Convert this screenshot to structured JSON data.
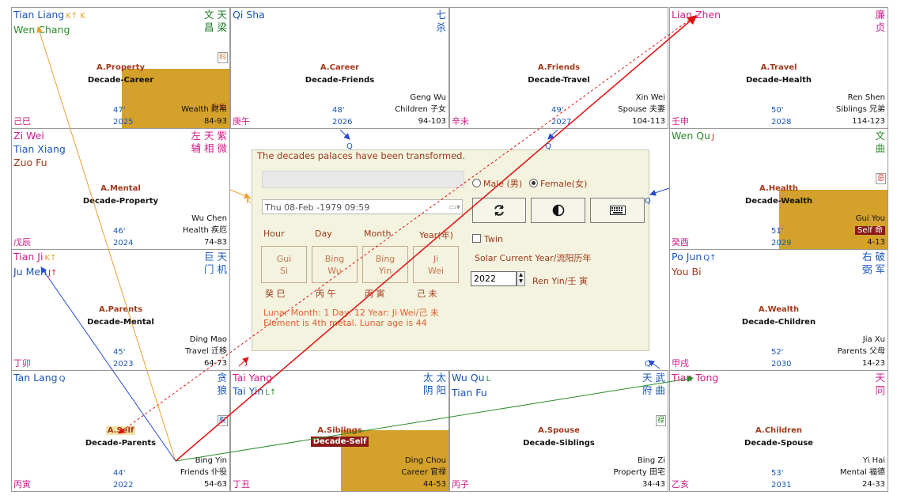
{
  "palaces": [
    {
      "id": "si",
      "stars_left": [
        {
          "text": "Tian Liang",
          "color": "#1a56b8",
          "mark": "K↑ K",
          "mark_color": "#e0a020"
        },
        {
          "text": "Wen Chang",
          "color": "#2a8a2a"
        }
      ],
      "stars_right": "文 天\n昌 梁",
      "stars_right_color": "#1a7a2a",
      "palace": "A.Property",
      "decade": "Decade-Career",
      "branch": "己巳",
      "age": "47'",
      "year": "2025",
      "palace_name": "Wealth 财帛",
      "range": "84-93",
      "major": "",
      "badge": "科",
      "badge_color": "#c87a3a",
      "gold": true,
      "kstr": "Ji Si"
    },
    {
      "id": "wu",
      "stars_left": [
        {
          "text": "Qi Sha",
          "color": "#1a56b8"
        }
      ],
      "stars_right": "七\n杀",
      "stars_right_color": "#1a56b8",
      "palace": "A.Career",
      "decade": "Decade-Friends",
      "branch": "庚午",
      "age": "48'",
      "year": "2026",
      "palace_name": "Children 子女",
      "range": "94-103",
      "major": "Geng Wu"
    },
    {
      "id": "wei",
      "stars_left": [],
      "stars_right": "",
      "palace": "A.Friends",
      "decade": "Decade-Travel",
      "branch": "辛未",
      "age": "49'",
      "year": "2027",
      "palace_name": "Spouse 夫妻",
      "range": "104-113",
      "major": "Xin Wei"
    },
    {
      "id": "shen",
      "stars_left": [
        {
          "text": "Lian Zhen",
          "color": "#cc1e8a"
        }
      ],
      "stars_right": "廉\n贞",
      "stars_right_color": "#cc1e8a",
      "palace": "A.Travel",
      "decade": "Decade-Health",
      "branch": "壬申",
      "age": "50'",
      "year": "2028",
      "palace_name": "Siblings 兄弟",
      "range": "114-123",
      "major": "Ren Shen"
    },
    {
      "id": "chen",
      "stars_left": [
        {
          "text": "Zi Wei",
          "color": "#cc1e8a"
        },
        {
          "text": "Tian Xiang",
          "color": "#1a56b8"
        },
        {
          "text": "Zuo Fu",
          "color": "#a03a1c"
        }
      ],
      "stars_right": "左 天 紫\n辅 相 微",
      "stars_right_color": "#cc1e8a",
      "palace": "A.Mental",
      "decade": "Decade-Property",
      "branch": "戊辰",
      "age": "46'",
      "year": "2024",
      "palace_name": "Health 疾厄",
      "range": "74-83",
      "major": "Wu Chen"
    },
    {
      "id": "you",
      "stars_left": [
        {
          "text": "Wen Qu",
          "color": "#2a8a2a",
          "mark": "J",
          "mark_color": "#c22"
        }
      ],
      "stars_right": "文\n曲",
      "stars_right_color": "#2a8a2a",
      "palace": "A.Health",
      "decade": "Decade-Wealth",
      "branch": "癸酉",
      "age": "51'",
      "year": "2029",
      "palace_name": "Self 命",
      "range": "4-13",
      "major": "Gui You",
      "badge": "忌",
      "badge_color": "#c22",
      "gold": true,
      "self_name": true
    },
    {
      "id": "mao",
      "stars_left": [
        {
          "text": "Tian Ji",
          "color": "#cc1e8a",
          "mark": "K↑",
          "mark_color": "#e0a020"
        },
        {
          "text": "Ju Men",
          "color": "#1a56b8",
          "mark": "J↑",
          "mark_color": "#c22"
        }
      ],
      "stars_right": "巨 天\n门 机",
      "stars_right_color": "#1a56b8",
      "palace": "A.Parents",
      "decade": "Decade-Mental",
      "branch": "丁卯",
      "age": "45'",
      "year": "2023",
      "palace_name": "Travel 迁移",
      "range": "64-73",
      "major": "Ding Mao"
    },
    {
      "id": "xu",
      "stars_left": [
        {
          "text": "Po Jun",
          "color": "#1a56b8",
          "mark": "Q↑",
          "mark_color": "#1a56b8"
        },
        {
          "text": "You Bi",
          "color": "#a03a1c"
        }
      ],
      "stars_right": "右 破\n弼 军",
      "stars_right_color": "#1a56b8",
      "palace": "A.Wealth",
      "decade": "Decade-Children",
      "branch": "甲戌",
      "age": "52'",
      "year": "2030",
      "palace_name": "Parents 父母",
      "range": "14-23",
      "major": "Jia Xu"
    },
    {
      "id": "yin",
      "stars_left": [
        {
          "text": "Tan Lang",
          "color": "#1a56b8",
          "mark": "Q",
          "mark_color": "#1a56b8"
        }
      ],
      "stars_right": "贪\n狼",
      "stars_right_color": "#1a56b8",
      "palace": "A.Self",
      "decade": "Decade-Parents",
      "branch": "丙寅",
      "age": "44'",
      "year": "2022",
      "palace_name": "Friends 仆役",
      "range": "54-63",
      "major": "Bing Yin",
      "badge": "权",
      "badge_color": "#1a56b8",
      "hl": true
    },
    {
      "id": "chou",
      "stars_left": [
        {
          "text": "Tai Yang",
          "color": "#cc1e8a"
        },
        {
          "text": "Tai Yin",
          "color": "#1a56b8",
          "mark": "L↑",
          "mark_color": "#2a8a2a"
        }
      ],
      "stars_right": "太 太\n阴 阳",
      "stars_right_color": "#1a56b8",
      "palace": "A.Siblings",
      "decade": "Decade-Self",
      "branch": "丁丑",
      "age": "",
      "year": "",
      "palace_name": "Career 官禄",
      "range": "44-53",
      "major": "Ding Chou",
      "gold": true,
      "self_decade": true
    },
    {
      "id": "zi",
      "stars_left": [
        {
          "text": "Wu Qu",
          "color": "#1a56b8",
          "mark": "L",
          "mark_color": "#2a8a2a"
        },
        {
          "text": "Tian Fu",
          "color": "#1a56b8"
        }
      ],
      "stars_right": "天 武\n府 曲",
      "stars_right_color": "#1a56b8",
      "palace": "A.Spouse",
      "decade": "Decade-Siblings",
      "branch": "丙子",
      "age": "",
      "year": "",
      "palace_name": "Property 田宅",
      "range": "34-43",
      "major": "Bing Zi",
      "badge": "禄",
      "badge_color": "#2a8a2a"
    },
    {
      "id": "hai",
      "stars_left": [
        {
          "text": "Tian Tong",
          "color": "#cc1e8a"
        }
      ],
      "stars_right": "天\n同",
      "stars_right_color": "#cc1e8a",
      "palace": "A.Children",
      "decade": "Decade-Spouse",
      "branch": "乙亥",
      "age": "53'",
      "year": "2031",
      "palace_name": "Mental 福德",
      "range": "24-33",
      "major": "Yi Hai"
    }
  ],
  "dialog": {
    "message": "The decades palaces have been transformed.",
    "date_value": "Thu  08-Feb -1979 09:59",
    "gender_male": "Male (男)",
    "gender_female": "Female(女)",
    "headers": {
      "hour": "Hour",
      "day": "Day",
      "month": "Month",
      "year": "Year(年)"
    },
    "pillars": [
      {
        "top": "Gui",
        "bottom": "Si",
        "cn": "癸 巳"
      },
      {
        "top": "Bing",
        "bottom": "Wu",
        "cn": "丙 午"
      },
      {
        "top": "Bing",
        "bottom": "Yin",
        "cn": "丙 寅"
      },
      {
        "top": "Ji",
        "bottom": "Wei",
        "cn": "己 未"
      }
    ],
    "info1": "Lunar Month: 1   Day: 12   Year: Ji Wei/己 未",
    "info2": "Element is 4th metal.   Lunar age is 44",
    "twin_label": "Twin",
    "solar_label": "Solar Current Year/流阳历年",
    "current_year": "2022",
    "year_ganzhi": "Ren Yin/壬 寅"
  },
  "edge_marks": {
    "q": "Q",
    "j": "J"
  }
}
